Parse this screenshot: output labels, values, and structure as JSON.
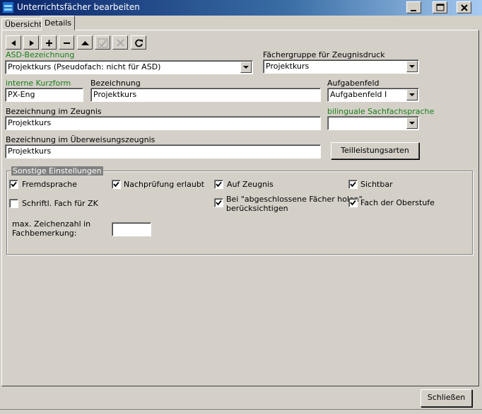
{
  "window": {
    "title": "Unterrichtsfächer bearbeiten",
    "controls": [
      "minimize",
      "maximize",
      "close"
    ]
  },
  "tabs": [
    {
      "label": "Übersicht",
      "active": false
    },
    {
      "label": "Details",
      "active": true
    }
  ],
  "toolbar": {
    "buttons": [
      "arrow-left-icon",
      "arrow-right-icon",
      "plus-icon",
      "minus-icon",
      "triangle-up-icon",
      "checkmark-icon",
      "cross-icon",
      "refresh-icon"
    ]
  },
  "form": {
    "asd": {
      "label": "ASD-Bezeichnung",
      "value": "Projektkurs (Pseudofach: nicht für ASD)"
    },
    "faechergruppe": {
      "label": "Fächergruppe für Zeugnisdruck",
      "value": "Projektkurs"
    },
    "kurzform": {
      "label": "interne Kurzform",
      "value": "PX-Eng"
    },
    "bezeichnung": {
      "label": "Bezeichnung",
      "value": "Projektkurs"
    },
    "aufgabenfeld": {
      "label": "Aufgabenfeld",
      "value": "Aufgabenfeld I"
    },
    "zeugnis": {
      "label": "Bezeichnung im Zeugnis",
      "value": "Projektkurs"
    },
    "bilingual": {
      "label": "bilinguale Sachfachsprache",
      "value": ""
    },
    "ueberweisung": {
      "label": "Bezeichnung im Überweisungszeugnis",
      "value": "Projektkurs"
    },
    "teilleistung_button": "Teilleistungsarten"
  },
  "settings": {
    "title": "Sonstige Einstellungen",
    "fremdsprache": {
      "label": "Fremdsprache",
      "checked": true
    },
    "nachpruefung": {
      "label": "Nachprüfung erlaubt",
      "checked": true
    },
    "aufzeugnis": {
      "label": "Auf Zeugnis",
      "checked": true
    },
    "sichtbar": {
      "label": "Sichtbar",
      "checked": true
    },
    "schriftlich": {
      "label": "Schriftl. Fach für ZK",
      "checked": false
    },
    "abgeschlossen": {
      "label_line1": "Bei \"abgeschlossene Fächer holen\"",
      "label_line2": "berücksichtigen",
      "checked": true
    },
    "oberstufe": {
      "label": "Fach der Oberstufe",
      "checked": true
    },
    "zeichenzahl": {
      "label_line1": "max. Zeichenzahl in",
      "label_line2": "Fachbemerkung:",
      "value": ""
    }
  },
  "footer": {
    "close_button": "Schließen"
  }
}
